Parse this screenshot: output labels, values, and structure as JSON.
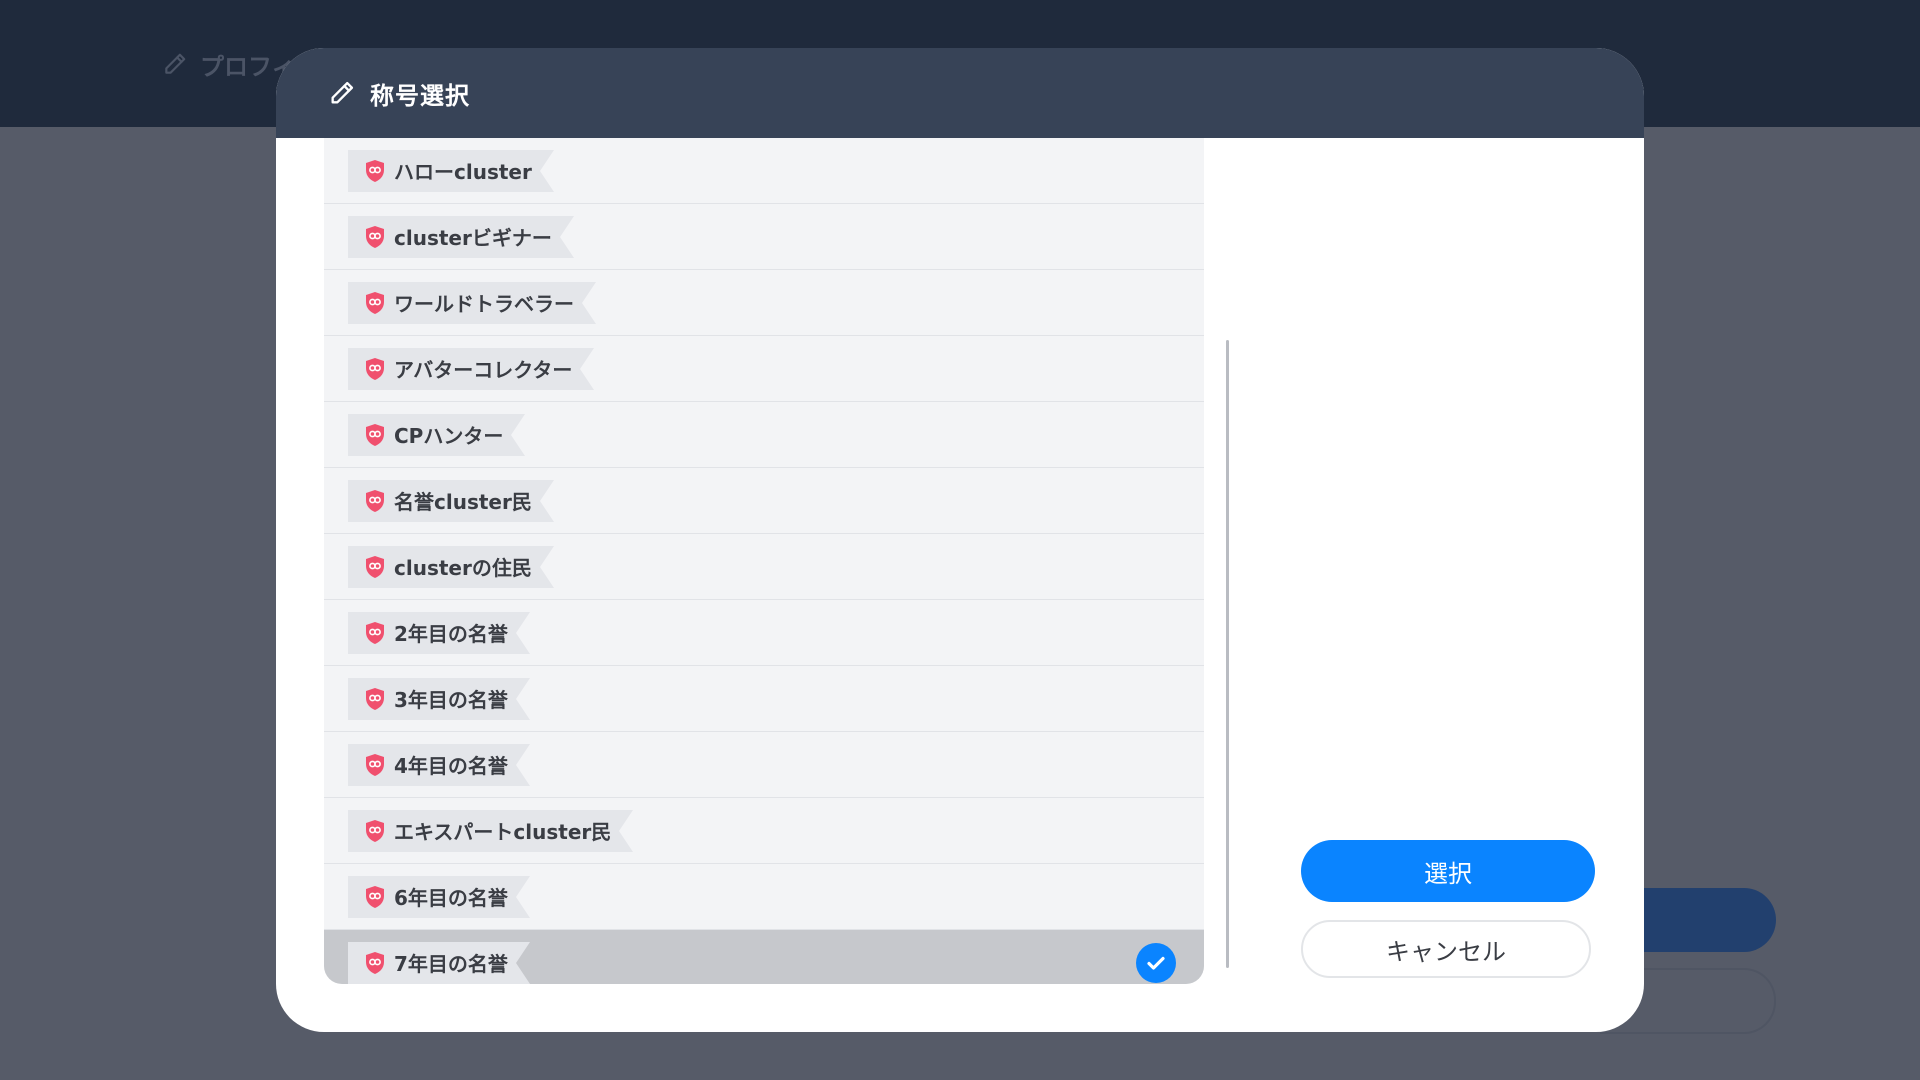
{
  "background": {
    "page_title": "プロフィ"
  },
  "modal": {
    "title": "称号選択",
    "titles": [
      {
        "label": "ハローcluster",
        "selected": false
      },
      {
        "label": "clusterビギナー",
        "selected": false
      },
      {
        "label": "ワールドトラベラー",
        "selected": false
      },
      {
        "label": "アバターコレクター",
        "selected": false
      },
      {
        "label": "CPハンター",
        "selected": false
      },
      {
        "label": "名誉cluster民",
        "selected": false
      },
      {
        "label": "clusterの住民",
        "selected": false
      },
      {
        "label": "2年目の名誉",
        "selected": false
      },
      {
        "label": "3年目の名誉",
        "selected": false
      },
      {
        "label": "4年目の名誉",
        "selected": false
      },
      {
        "label": "エキスパートcluster民",
        "selected": false
      },
      {
        "label": "6年目の名誉",
        "selected": false
      },
      {
        "label": "7年目の名誉",
        "selected": true
      }
    ],
    "select_label": "選択",
    "cancel_label": "キャンセル"
  },
  "colors": {
    "accent": "#0a84ff",
    "header": "#374357",
    "badge": "#f0506e"
  },
  "icons": {
    "header": "pencil-icon",
    "badge": "shield-badge-icon",
    "selected": "checkmark-icon"
  }
}
